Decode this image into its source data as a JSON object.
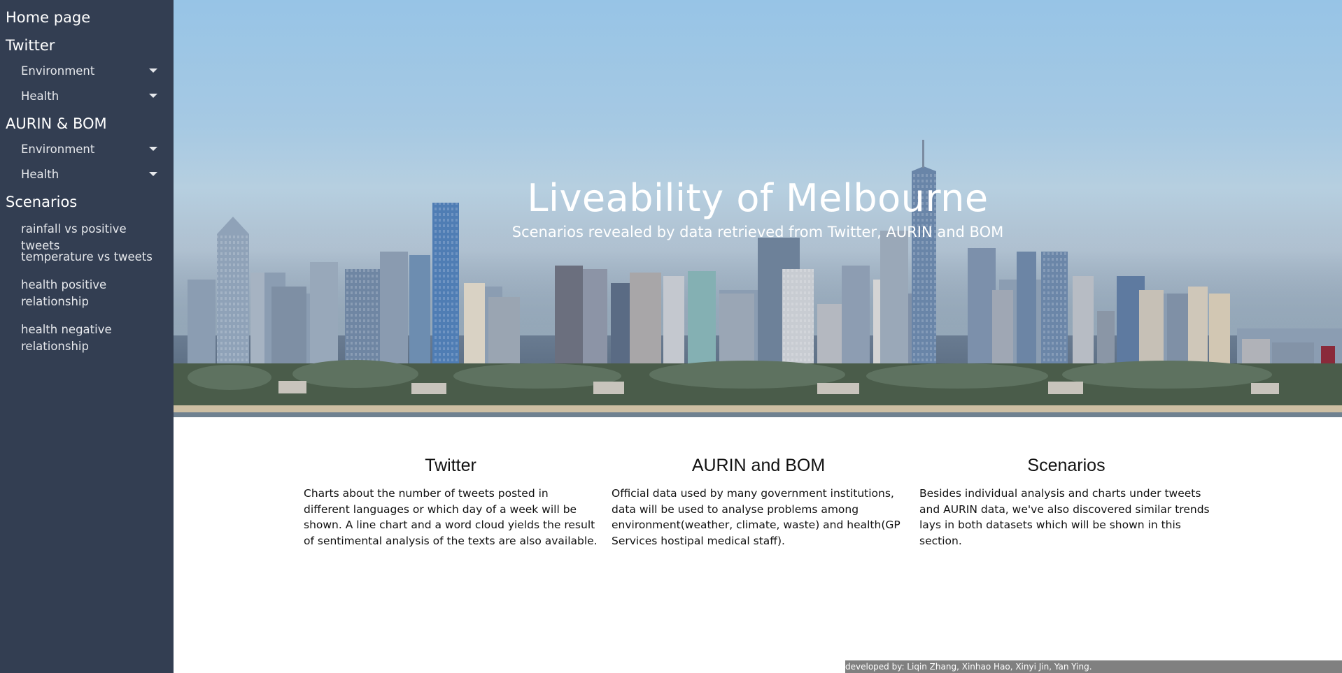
{
  "sidebar": {
    "home": "Home page",
    "twitter": {
      "title": "Twitter",
      "items": [
        "Environment",
        "Health"
      ]
    },
    "aurin": {
      "title": "AURIN & BOM",
      "items": [
        "Environment",
        "Health"
      ]
    },
    "scenarios": {
      "title": "Scenarios",
      "items": [
        "rainfall vs positive tweets",
        "temperature vs tweets",
        "health positive relationship",
        "health negative relationship"
      ]
    }
  },
  "hero": {
    "title": "Liveability of Melbourne",
    "subtitle": "Scenarios revealed by data retrieved from Twitter, AURIN and BOM"
  },
  "columns": [
    {
      "heading": "Twitter",
      "text": "Charts about the number of tweets posted in different languages or which day of a week will be shown. A line chart and a word cloud yields the result of sentimental analysis of the texts are also available."
    },
    {
      "heading": "AURIN and BOM",
      "text": "Official data used by many government institutions, data will be used to analyse problems among environment(weather, climate, waste) and health(GP Services hostipal medical staff)."
    },
    {
      "heading": "Scenarios",
      "text": "Besides individual analysis and charts under tweets and AURIN data, we've also discovered similar trends lays in both datasets which will be shown in this section."
    }
  ],
  "footer": "developed by: Liqin Zhang, Xinhao Hao, Xinyi Jin, Yan Ying.",
  "colors": {
    "sidebar_bg": "#333e52",
    "footer_bg": "#808080"
  }
}
